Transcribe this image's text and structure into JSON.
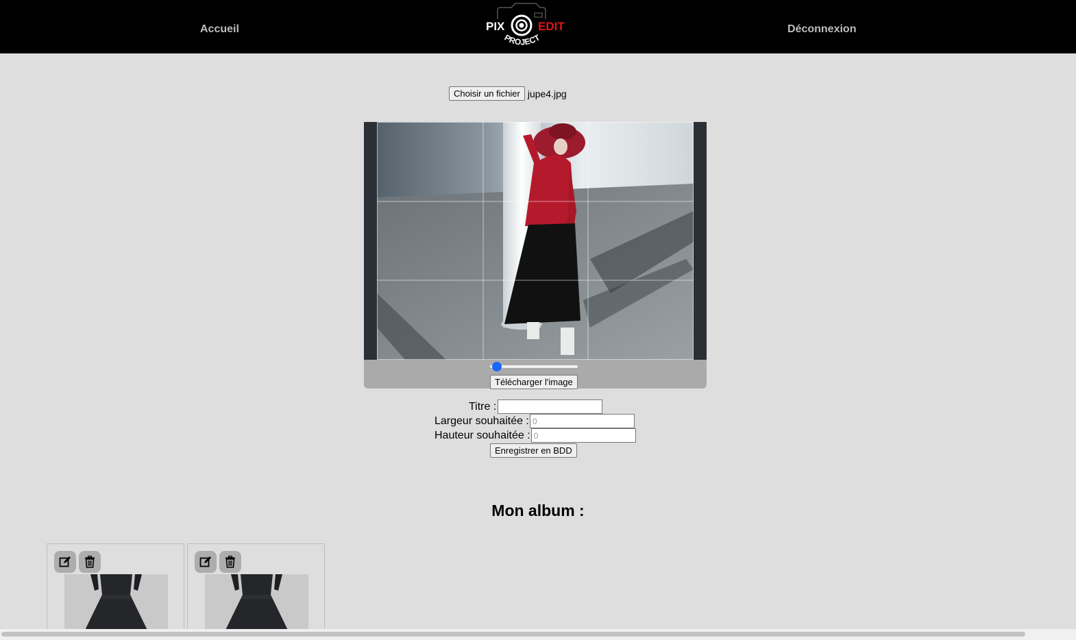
{
  "header": {
    "home_label": "Accueil",
    "logout_label": "Déconnexion",
    "logo": {
      "left_text": "PIX",
      "right_text": "EDIT",
      "bottom_text": "PROJECT",
      "accent": "#e0151b"
    }
  },
  "upload": {
    "choose_label": "Choisir un fichier",
    "file_name": "jupe4.jpg"
  },
  "editor": {
    "zoom_level": 0,
    "download_label": "Télécharger l'image"
  },
  "form": {
    "title_label": "Titre :",
    "title_value": "",
    "width_label": "Largeur souhaitée :",
    "width_placeholder": "0",
    "height_label": "Hauteur souhaitée :",
    "height_placeholder": "0",
    "save_label": "Enregistrer en BDD"
  },
  "album": {
    "heading": "Mon album :",
    "items": [
      {
        "edit_icon": "edit-icon",
        "delete_icon": "trash-icon"
      },
      {
        "edit_icon": "edit-icon",
        "delete_icon": "trash-icon"
      }
    ]
  },
  "colors": {
    "header_bg": "#000000",
    "page_bg": "#dedede",
    "slider_accent": "#1a66ff",
    "logo_red": "#e0151b"
  }
}
